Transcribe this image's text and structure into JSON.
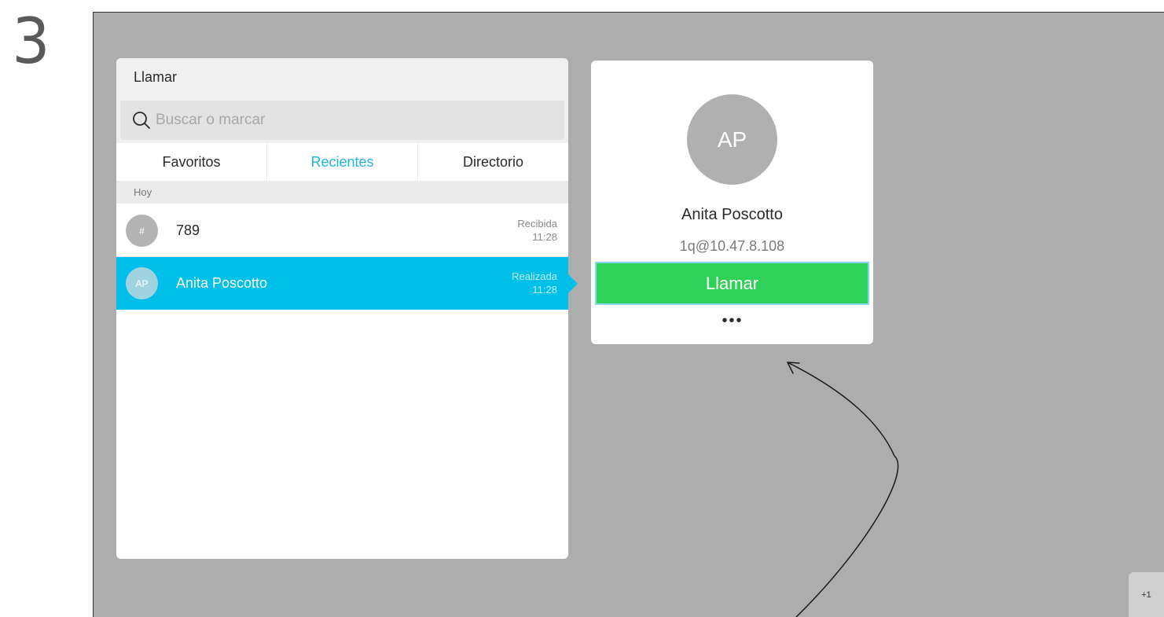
{
  "step_number": "3",
  "call_panel": {
    "title": "Llamar",
    "search": {
      "placeholder": "Buscar o marcar",
      "value": ""
    },
    "tabs": [
      {
        "label": "Favoritos",
        "active": false
      },
      {
        "label": "Recientes",
        "active": true
      },
      {
        "label": "Directorio",
        "active": false
      }
    ],
    "section": "Hoy",
    "recents": [
      {
        "avatar": "#",
        "name": "789",
        "status": "Recibida",
        "time": "11:28",
        "selected": false
      },
      {
        "avatar": "AP",
        "name": "Anita Poscotto",
        "status": "Realizada",
        "time": "11:28",
        "selected": true
      }
    ]
  },
  "contact_card": {
    "initials": "AP",
    "name": "Anita Poscotto",
    "address": "1q@10.47.8.108",
    "call_label": "Llamar",
    "more_label": "•••"
  },
  "badge": "+1",
  "icons": {
    "search": "search-icon",
    "more": "more-options-icon"
  },
  "colors": {
    "accent": "#00bfe8",
    "tab_active": "#1fb6d9",
    "call_button": "#30d158",
    "screen_background": "#adadad"
  }
}
